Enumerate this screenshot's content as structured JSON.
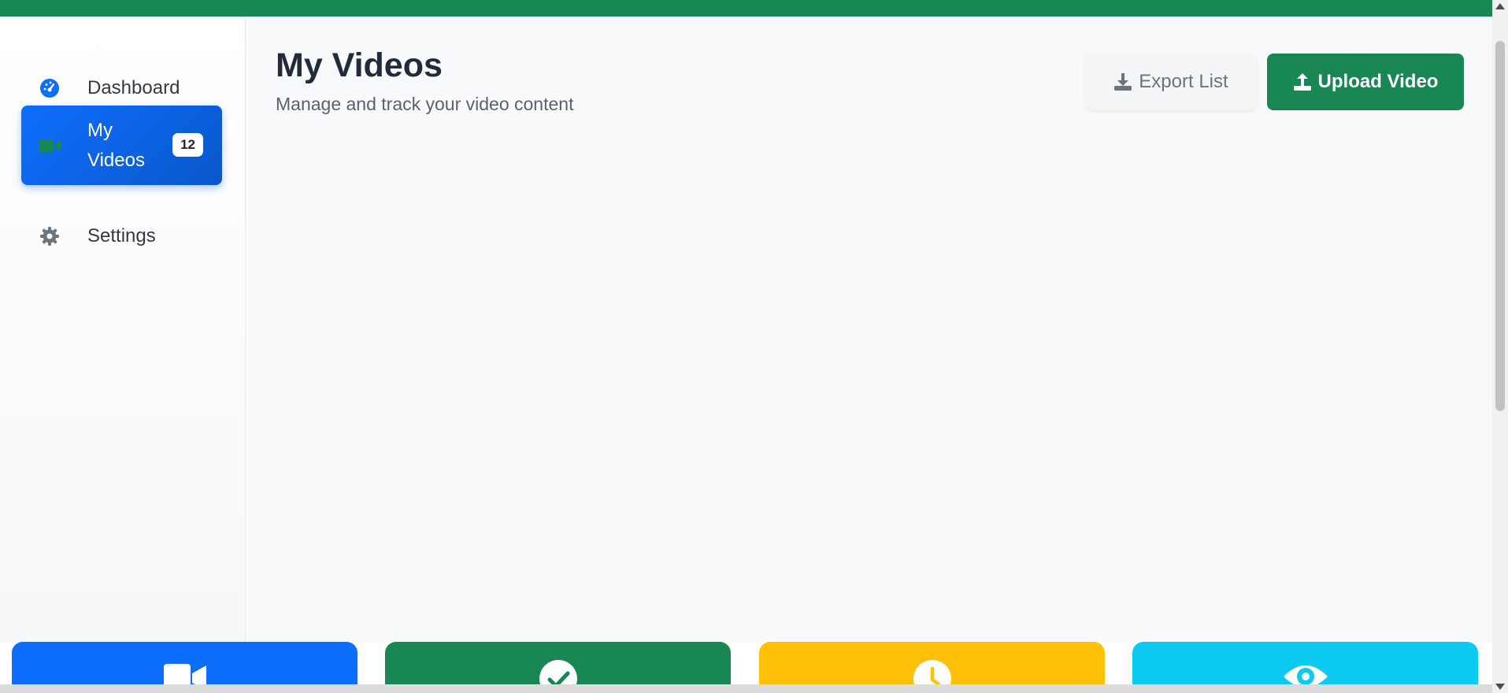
{
  "colors": {
    "topbar": "#198754",
    "primary": "#0d6efd",
    "success": "#198754",
    "warning": "#ffc107",
    "info": "#0dcaf0"
  },
  "sidebar": {
    "items": [
      {
        "label": "Dashboard",
        "icon": "gauge-icon",
        "active": false
      },
      {
        "label": "My Videos",
        "icon": "video-camera-icon",
        "active": true,
        "badge": "12"
      },
      {
        "label": "Settings",
        "icon": "gear-icon",
        "active": false
      }
    ]
  },
  "header": {
    "title": "My Videos",
    "subtitle": "Manage and track your video content"
  },
  "actions": {
    "export_label": "Export List",
    "upload_label": "Upload Video"
  },
  "stat_cards": [
    {
      "icon": "video-camera-icon",
      "color": "#0d6efd"
    },
    {
      "icon": "check-circle-icon",
      "color": "#198754"
    },
    {
      "icon": "clock-icon",
      "color": "#ffc107"
    },
    {
      "icon": "eye-icon",
      "color": "#0dcaf0"
    }
  ]
}
